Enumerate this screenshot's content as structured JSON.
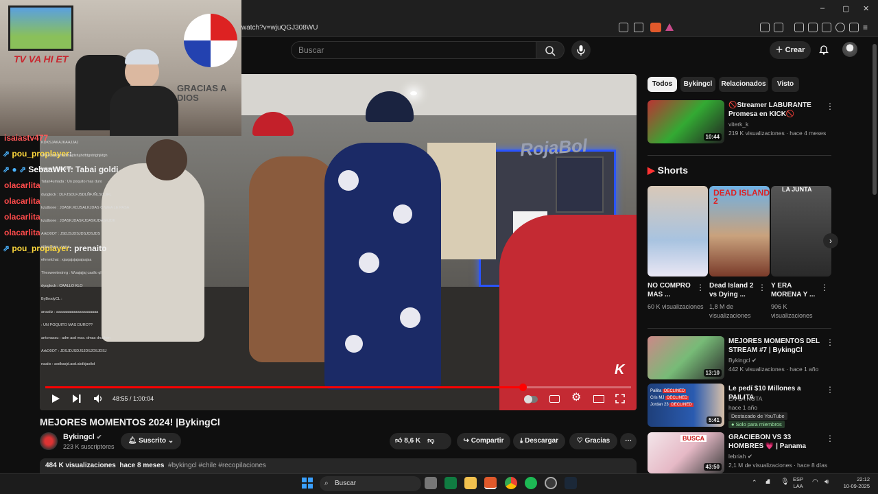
{
  "browser": {
    "url": "watch?v=wjuQGJ308WU",
    "window_controls": [
      "–",
      "▢",
      "✕"
    ]
  },
  "header": {
    "search_placeholder": "Buscar",
    "create_label": "Crear"
  },
  "stream_overlay": {
    "webcam_sign": "TV VA HI ET",
    "banner_text": "GRACIAS A DIOS",
    "chat_big": [
      {
        "user": "isaiastv477",
        "text": "",
        "color": "#ff5a5a"
      },
      {
        "user": "pou_proplayer",
        "text": ":",
        "color": "#ffd93d"
      },
      {
        "user": "SebaaWKT",
        "text": ": Tabai goldi",
        "color": "#ffffff"
      },
      {
        "user": "olacarlita",
        "text": "",
        "color": "#ff4b4b"
      },
      {
        "user": "olacarlita",
        "text": "",
        "color": "#ff4b4b"
      },
      {
        "user": "olacarlita",
        "text": "",
        "color": "#ff4b4b"
      },
      {
        "user": "olacarlita",
        "text": "",
        "color": "#ff4b4b"
      },
      {
        "user": "pou_proplayer",
        "text": ": prenaito",
        "color": "#ffd93d"
      }
    ],
    "chat_small": [
      "KDKSJAKAJKAAJJAJ",
      "JKKKSanbmsdfhbjdsfujhdfdgnbfghjkfgh",
      "jasjasjasjasjasjajsa",
      "Tatan4umada : Un poquito mas duro",
      "dyoglock : DLFJSDLFJSDLÑFJÑLSD.JFL",
      "kzutboee : JDASK.KDJSALKJDAS O WEA LE PASA",
      "kzutboee : JDASKJDASKJDASKJDASKJDK",
      "ArkO0OT : JSDJSJDSJDSJDSJDS",
      "ojitosxnes : yerra",
      "efenelchat : xjasjajsjajsajsajsa",
      "Thesweetestnrg : Wuajajjaj caallo ql",
      "dyoglock : CAALLO KLO",
      "ByBrodyCL : ",
      "anaaiiz : aaaaaaaaaaaaaaaaaaaa",
      ": UN POQUITO MAS DURO??",
      "antonassu : adm asd mas. dmas dnadom",
      "ArkO0OT : JDSJDJSDJSJDSJDSJDSJ",
      "naaiis : asdkasjd.asd.akdkjasikd"
    ]
  },
  "player": {
    "time_current": "48:55",
    "time_sep": " / ",
    "time_total": "1:00:04",
    "progress_fraction": 0.8145,
    "wall_sign": "RojaBol"
  },
  "video": {
    "title": "MEJORES MOMENTOS 2024! |BykingCl",
    "channel": "Bykingcl",
    "subscribers": "223 K suscriptores",
    "subscribed_label": "Suscrito",
    "likes": "8,6 K",
    "share_label": "Compartir",
    "download_label": "Descargar",
    "thanks_label": "Gracias",
    "views": "484 K visualizaciones",
    "age": "hace 8 meses",
    "hashtags": "#bykingcl #chile #recopilaciones"
  },
  "sidebar": {
    "chips": [
      "Todos",
      "Bykingcl",
      "Relacionados",
      "Visto"
    ],
    "first": {
      "title": "🚫Streamer LABURANTE Promesa en KICK🚫",
      "channel": "viterk_k",
      "meta": "219 K visualizaciones · hace 4 meses",
      "duration": "10:44"
    },
    "shorts_heading": "Shorts",
    "shorts": [
      {
        "title": "NO COMPRO MAS ...",
        "meta": "60 K visualizaciones",
        "overlay": ""
      },
      {
        "title": "Dead Island 2 vs Dying ...",
        "meta": "1,8 M de visualizaciones",
        "overlay": "DEAD ISLAND 2"
      },
      {
        "title": "Y ERA MORENA Y ...",
        "meta": "906 K visualizaciones",
        "overlay": "LA JUNTA"
      }
    ],
    "videos": [
      {
        "title": "MEJORES MOMENTOS DEL STREAM #7 | BykingCl",
        "channel": "Bykingcl",
        "meta": "442 K visualizaciones · hace 1 año",
        "duration": "13:10",
        "badge": "",
        "members": ""
      },
      {
        "title": "Le pedí $10 Millones a PAILITA",
        "channel": "EN LA NOTA",
        "meta": "hace 1 año",
        "duration": "5:41",
        "badge": "Destacado de YouTube",
        "members": "Solo para miembros"
      },
      {
        "title": "GRACIEBON VS 33 HOMBRES 💗 | Panama",
        "channel": "lebriah",
        "meta": "2,1 M de visualizaciones · hace 8 días",
        "duration": "43:50",
        "badge": "",
        "members": ""
      }
    ],
    "thumb_texts": [
      "Pailita",
      "Cris MJ",
      "Jordan 23",
      "DECLINED",
      "BUSCA"
    ]
  },
  "taskbar": {
    "search_label": "Buscar",
    "lang": "ESP",
    "lang_sub": "LAA",
    "time": "22:12",
    "date": "10-09-2025"
  },
  "colors": {
    "accent_red": "#ff0000",
    "bg": "#0f0f0f",
    "chip_active_bg": "#f1f1f1"
  }
}
